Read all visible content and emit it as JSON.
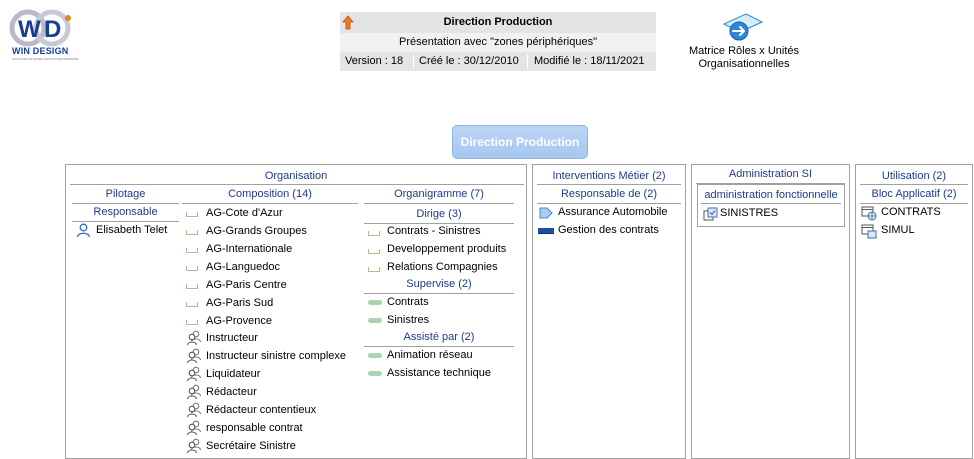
{
  "logo": {
    "text": "WIN DESIGN",
    "tagline": "SOLUTION DE MODELISATION D'ENTREPRISE"
  },
  "header": {
    "title": "Direction Production",
    "subtitle": "Présentation avec \"zones périphériques\"",
    "version": "Version : 18",
    "created": "Créé le : 30/12/2010",
    "modified": "Modifié le : 18/11/2021"
  },
  "matrix_link": {
    "line1": "Matrice Rôles x Unités",
    "line2": "Organisationnelles"
  },
  "center_button": "Direction Production",
  "organisation": {
    "title": "Organisation",
    "pilotage": {
      "title": "Pilotage",
      "responsable_title": "Responsable",
      "responsable": "Elisabeth Telet"
    },
    "composition": {
      "title": "Composition (14)",
      "units": [
        "AG-Cote d'Azur",
        "AG-Grands Groupes",
        "AG-Internationale",
        "AG-Languedoc",
        "AG-Paris Centre",
        "AG-Paris Sud",
        "AG-Provence"
      ],
      "roles": [
        "Instructeur",
        "Instructeur sinistre complexe",
        "Liquidateur",
        "Rédacteur",
        "Rédacteur contentieux",
        "responsable contrat",
        "Secrétaire Sinistre"
      ]
    },
    "organigramme": {
      "title": "Organigramme (7)",
      "dirige_title": "Dirige (3)",
      "dirige": [
        "Contrats - Sinistres",
        "Developpement produits",
        "Relations Compagnies"
      ],
      "supervise_title": "Supervise (2)",
      "supervise": [
        "Contrats",
        "Sinistres"
      ],
      "assiste_title": "Assisté par (2)",
      "assiste": [
        "Animation réseau",
        "Assistance technique"
      ]
    }
  },
  "interventions": {
    "title": "Interventions Métier (2)",
    "responsable_title": "Responsable de (2)",
    "items": [
      "Assurance Automobile",
      "Gestion des contrats"
    ]
  },
  "administration": {
    "title": "Administration SI",
    "sub_title": "administration fonctionnelle",
    "items": [
      "SINISTRES"
    ]
  },
  "utilisation": {
    "title": "Utilisation (2)",
    "sub_title": "Bloc Applicatif (2)",
    "items": [
      "CONTRATS",
      "SIMUL"
    ]
  },
  "colors": {
    "title_blue": "#1f3a8a",
    "button_blue": "#a6c7f1",
    "pill_green": "#a9d3b1",
    "bracket_olive": "#b7b791",
    "process_blue": "#1f4fa0"
  }
}
